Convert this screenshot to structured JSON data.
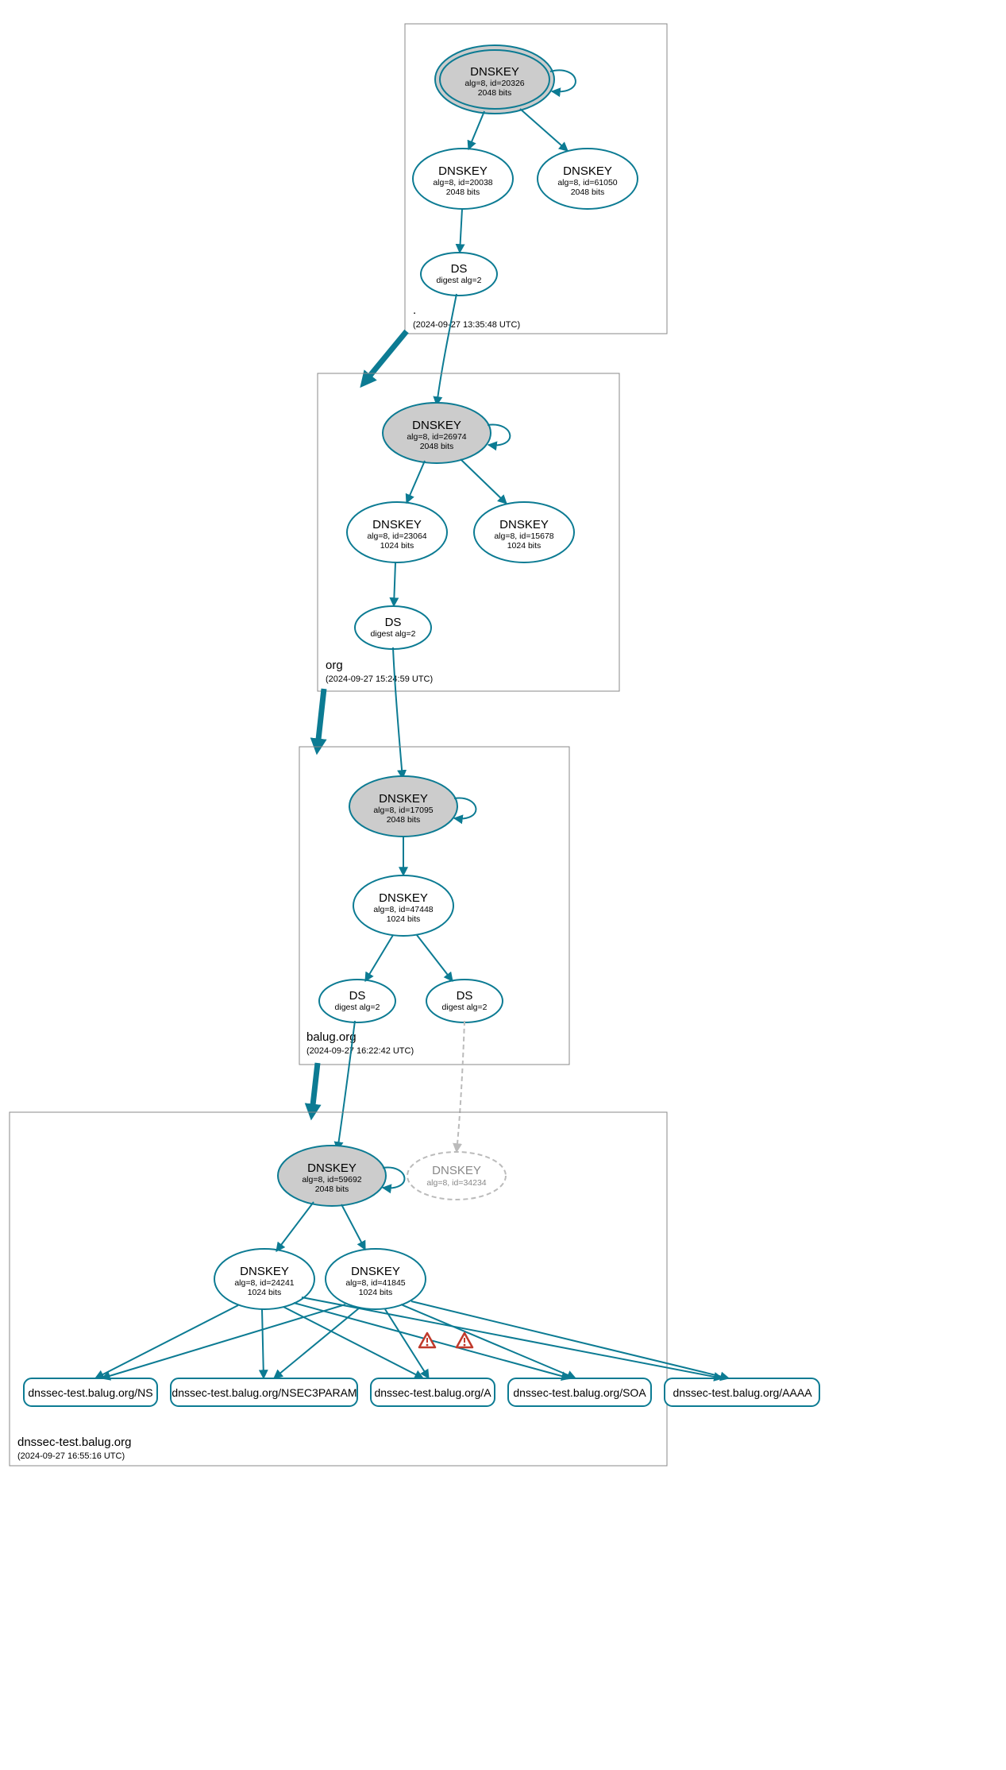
{
  "zones": {
    "root": {
      "name": ".",
      "timestamp": "(2024-09-27 13:35:48 UTC)",
      "ksk": {
        "label": "DNSKEY",
        "alg": "alg=8, id=20326",
        "bits": "2048 bits"
      },
      "zsk_a": {
        "label": "DNSKEY",
        "alg": "alg=8, id=20038",
        "bits": "2048 bits"
      },
      "zsk_b": {
        "label": "DNSKEY",
        "alg": "alg=8, id=61050",
        "bits": "2048 bits"
      },
      "ds": {
        "label": "DS",
        "alg": "digest alg=2"
      }
    },
    "org": {
      "name": "org",
      "timestamp": "(2024-09-27 15:24:59 UTC)",
      "ksk": {
        "label": "DNSKEY",
        "alg": "alg=8, id=26974",
        "bits": "2048 bits"
      },
      "zsk_a": {
        "label": "DNSKEY",
        "alg": "alg=8, id=23064",
        "bits": "1024 bits"
      },
      "zsk_b": {
        "label": "DNSKEY",
        "alg": "alg=8, id=15678",
        "bits": "1024 bits"
      },
      "ds": {
        "label": "DS",
        "alg": "digest alg=2"
      }
    },
    "balug": {
      "name": "balug.org",
      "timestamp": "(2024-09-27 16:22:42 UTC)",
      "ksk": {
        "label": "DNSKEY",
        "alg": "alg=8, id=17095",
        "bits": "2048 bits"
      },
      "zsk": {
        "label": "DNSKEY",
        "alg": "alg=8, id=47448",
        "bits": "1024 bits"
      },
      "ds_a": {
        "label": "DS",
        "alg": "digest alg=2"
      },
      "ds_b": {
        "label": "DS",
        "alg": "digest alg=2"
      }
    },
    "dnssec_test": {
      "name": "dnssec-test.balug.org",
      "timestamp": "(2024-09-27 16:55:16 UTC)",
      "ksk": {
        "label": "DNSKEY",
        "alg": "alg=8, id=59692",
        "bits": "2048 bits"
      },
      "revoked": {
        "label": "DNSKEY",
        "alg": "alg=8, id=34234"
      },
      "zsk_a": {
        "label": "DNSKEY",
        "alg": "alg=8, id=24241",
        "bits": "1024 bits"
      },
      "zsk_b": {
        "label": "DNSKEY",
        "alg": "alg=8, id=41845",
        "bits": "1024 bits"
      },
      "rrsets": {
        "ns": "dnssec-test.balug.org/NS",
        "nsec3param": "dnssec-test.balug.org/NSEC3PARAM",
        "a": "dnssec-test.balug.org/A",
        "soa": "dnssec-test.balug.org/SOA",
        "aaaa": "dnssec-test.balug.org/AAAA"
      }
    }
  },
  "icons": {
    "warning": "⚠"
  }
}
